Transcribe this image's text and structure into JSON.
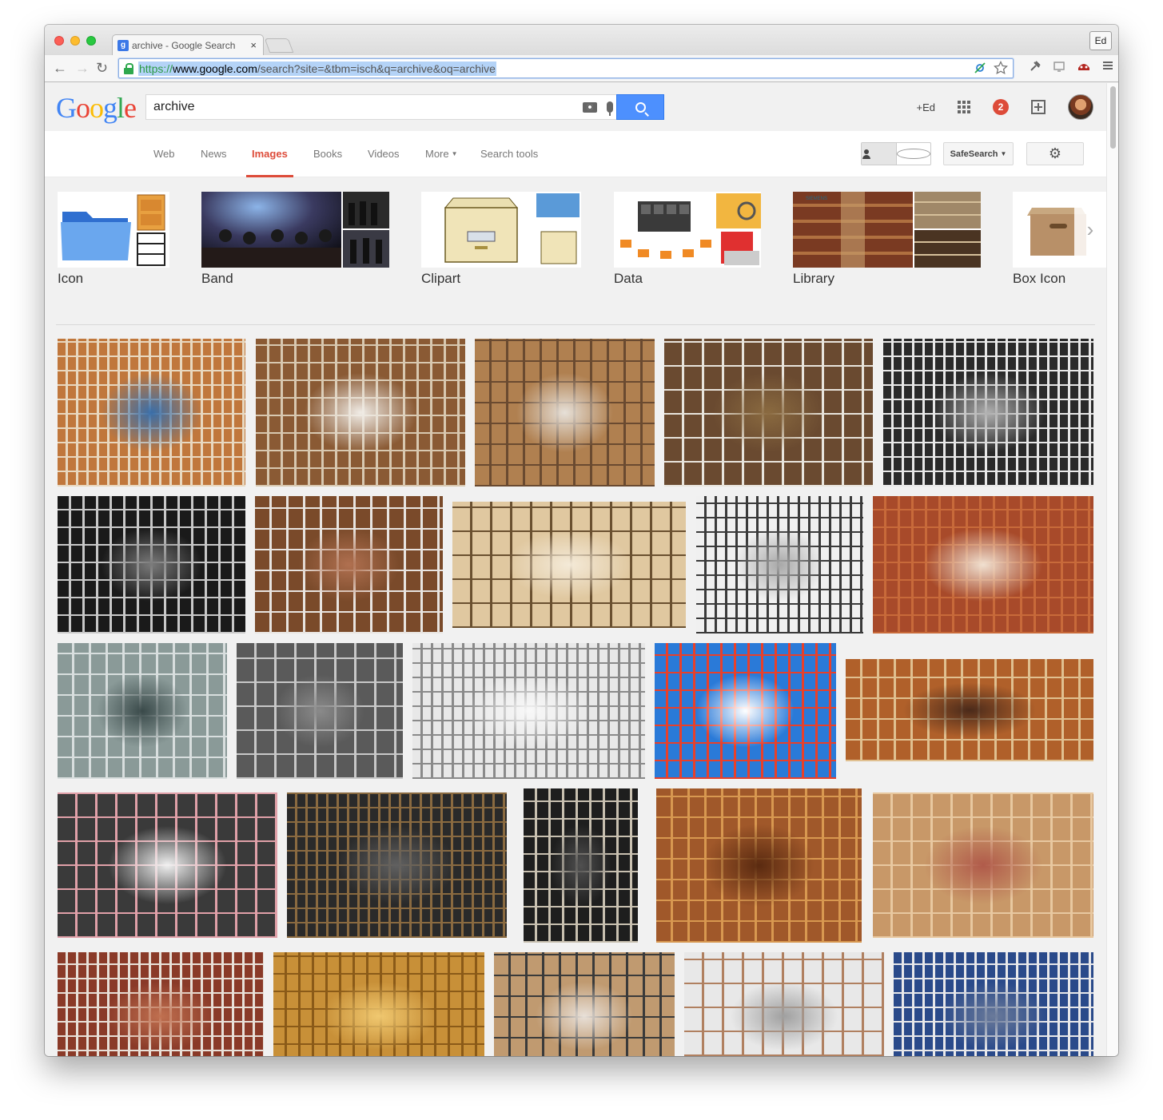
{
  "browser": {
    "tab_title": "archive - Google Search",
    "tab_favicon": "g",
    "tab_close": "×",
    "profile": "Ed",
    "url_scheme": "https://",
    "url_host": "www.google.com",
    "url_path": "/search?site=&tbm=isch&q=archive&oq=archive",
    "nav_back": "←",
    "nav_forward": "→",
    "nav_reload": "↻",
    "omni_icons": [
      "translate-icon",
      "star-icon"
    ],
    "ext_icons": [
      "pin-icon",
      "cast-icon",
      "extension-icon",
      "menu-icon"
    ]
  },
  "google": {
    "logo": [
      "G",
      "o",
      "o",
      "g",
      "l",
      "e"
    ],
    "query": "archive",
    "plus_user": "+Ed",
    "notification_count": "2",
    "nav": [
      {
        "label": "Web",
        "active": false
      },
      {
        "label": "News",
        "active": false
      },
      {
        "label": "Images",
        "active": true
      },
      {
        "label": "Books",
        "active": false
      },
      {
        "label": "Videos",
        "active": false
      },
      {
        "label": "More",
        "active": false
      },
      {
        "label": "Search tools",
        "active": false
      }
    ],
    "safesearch": "SafeSearch",
    "gear": "⚙",
    "related": [
      {
        "label": "Icon"
      },
      {
        "label": "Band"
      },
      {
        "label": "Clipart"
      },
      {
        "label": "Data"
      },
      {
        "label": "Library"
      },
      {
        "label": "Box Icon"
      }
    ],
    "related_next": "›"
  },
  "colors": {
    "accent_red": "#dd4b39",
    "search_blue": "#4d90fe"
  }
}
